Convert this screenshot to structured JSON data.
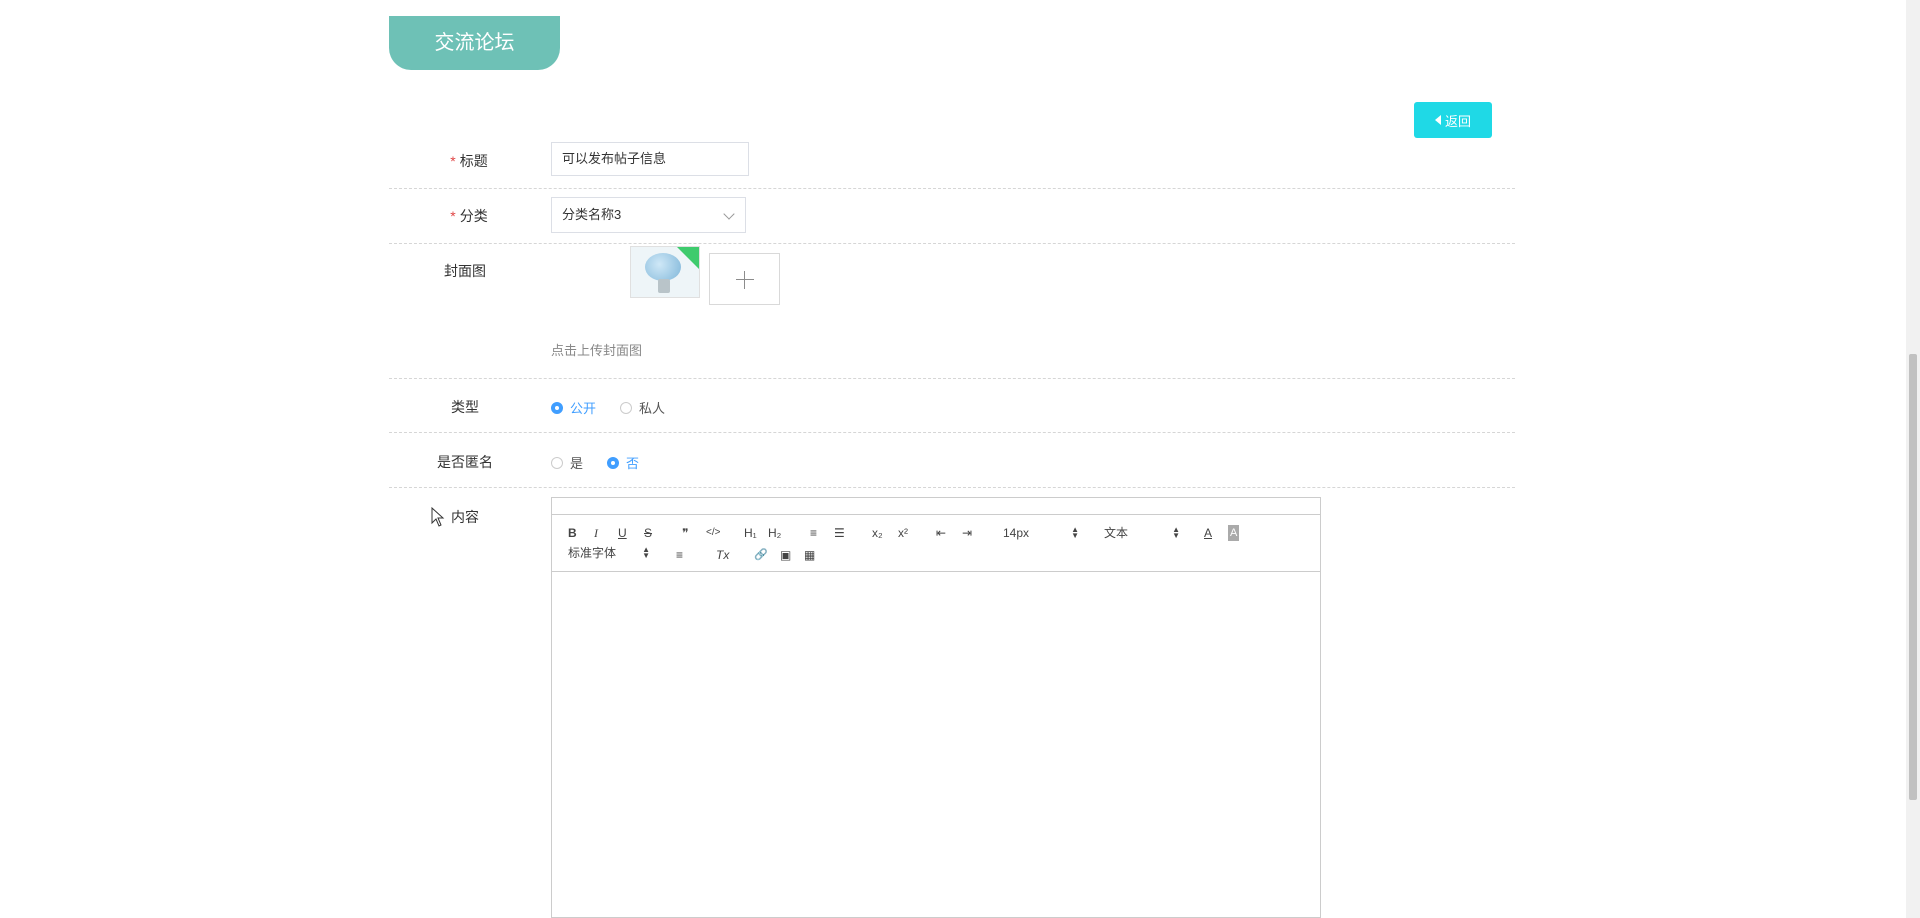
{
  "header": {
    "title": "交流论坛"
  },
  "back_button": {
    "label": "返回"
  },
  "form": {
    "title": {
      "label": "标题",
      "required_mark": "*",
      "value": "可以发布帖子信息"
    },
    "category": {
      "label": "分类",
      "required_mark": "*",
      "value": "分类名称3"
    },
    "cover": {
      "label": "封面图",
      "hint": "点击上传封面图"
    },
    "type": {
      "label": "类型",
      "options": [
        "公开",
        "私人"
      ],
      "selected": "公开"
    },
    "anonymous": {
      "label": "是否匿名",
      "options": [
        "是",
        "否"
      ],
      "selected": "否"
    },
    "content": {
      "label": "内容"
    }
  },
  "editor": {
    "toolbar": {
      "bold": "B",
      "italic": "I",
      "underline": "U",
      "strike": "S",
      "blockquote": "❞",
      "code": "</>",
      "h1": "H₁",
      "h2": "H₂",
      "ordered_list": "≡",
      "bullet_list": "☰",
      "subscript": "x₂",
      "superscript": "x²",
      "outdent": "⇤",
      "indent": "⇥",
      "size_picker": "14px",
      "header_picker": "文本",
      "color": "A",
      "background": "A",
      "font_picker": "标准字体",
      "align": "≡",
      "clean": "Tx",
      "link": "🔗",
      "image": "▣",
      "video": "▦"
    }
  }
}
